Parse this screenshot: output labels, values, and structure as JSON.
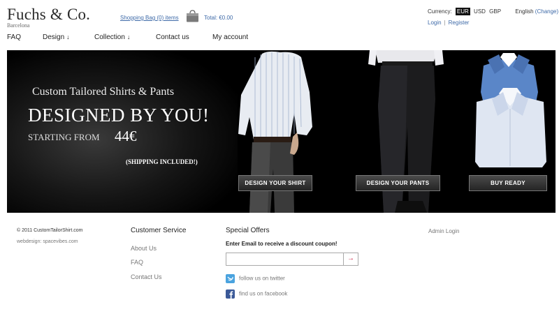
{
  "brand": {
    "title": "Fuchs & Co.",
    "subtitle": "Barcelona"
  },
  "cart": {
    "link": "Shopping Bag (0) items",
    "total": "Total: €0.00"
  },
  "currency": {
    "label": "Currency:",
    "options": [
      "EUR",
      "USD",
      "GBP"
    ],
    "selected": "EUR"
  },
  "language": {
    "current": "English",
    "change": "(Change)"
  },
  "account": {
    "login": "Login",
    "separator": "|",
    "register": "Register"
  },
  "nav": {
    "items": [
      "FAQ",
      "Design",
      "Collection",
      "Contact us",
      "My account"
    ],
    "dropdown_arrow": "↓"
  },
  "hero": {
    "line1": "Custom Tailored Shirts & Pants",
    "line2": "DESIGNED BY YOU!",
    "line3": "STARTING FROM",
    "price": "44€",
    "shipping": "(SHIPPING INCLUDED!)",
    "buttons": [
      "DESIGN YOUR SHIRT",
      "DESIGN YOUR PANTS",
      "BUY READY"
    ]
  },
  "footer": {
    "copyright": "© 2011 CustomTailorShirt.com",
    "webdesign": "webdesign: spacevibes.com",
    "customer_service": {
      "title": "Customer Service",
      "links": [
        "About Us",
        "FAQ",
        "Contact Us"
      ]
    },
    "special_offers": {
      "title": "Special Offers",
      "subtitle": "Enter Email to receive a discount coupon!",
      "placeholder": "",
      "submit_icon": "→"
    },
    "social": {
      "twitter": "follow us on twitter",
      "facebook": "find us on facebook"
    },
    "admin": "Admin Login"
  },
  "colors": {
    "link": "#3e6aa8",
    "hero_bg": "#000000",
    "accent_red": "#c8193c"
  }
}
